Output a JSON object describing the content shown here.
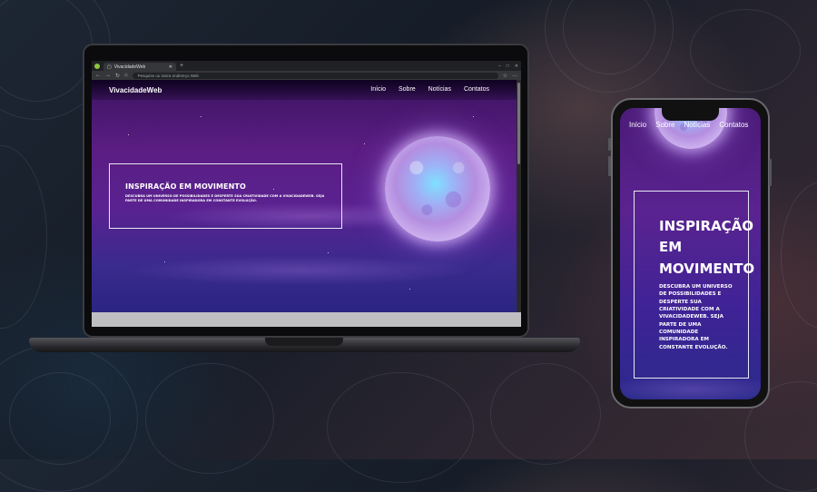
{
  "browser": {
    "tab_title": "VivacidadeWeb",
    "new_tab": "+",
    "address_placeholder": "Pesquise ou insira endereço Web",
    "window_controls": [
      "–",
      "□",
      "✕"
    ]
  },
  "site": {
    "brand": "VivacidadeWeb",
    "nav": [
      "Início",
      "Sobre",
      "Notícias",
      "Contatos"
    ],
    "hero_title": "INSPIRAÇÃO EM MOVIMENTO",
    "hero_text": "Descubra um universo de possibilidades e desperte sua criatividade com a VivacidadeWeb. Seja parte de uma comunidade inspiradora em constante evolução."
  },
  "phone_site": {
    "nav": [
      "Início",
      "Sobre",
      "Notícias",
      "Contatos"
    ],
    "hero_title": "INSPIRAÇÃO EM MOVIMENTO",
    "hero_text": "Descubra um universo de possibilidades e desperte sua criatividade com a VivacidadeWeb. Seja parte de uma comunidade inspiradora em constante evolução."
  },
  "icons": {
    "back": "←",
    "forward": "→",
    "reload": "↻",
    "home": "⌂",
    "favorite": "☆",
    "menu": "…"
  },
  "colors": {
    "purple_top": "#3b1460",
    "purple_mid": "#5b1d83",
    "indigo_bottom": "#2a2580",
    "text": "#ffffff"
  }
}
